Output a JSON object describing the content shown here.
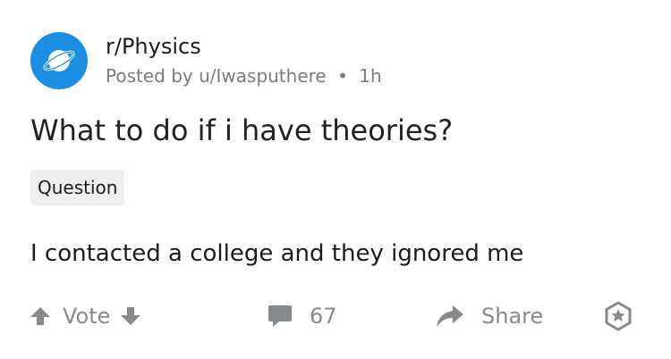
{
  "post": {
    "subreddit": "r/Physics",
    "author_prefix": "Posted by",
    "author": "u/Iwasputhere",
    "separator": "•",
    "time": "1h",
    "title": "What to do if i have theories?",
    "flair": "Question",
    "body": "I contacted a college and they ignored me"
  },
  "actions": {
    "vote_label": "Vote",
    "comment_count": "67",
    "share_label": "Share"
  },
  "icons": {
    "avatar": "planet-icon",
    "upvote": "arrow-up-icon",
    "downvote": "arrow-down-icon",
    "comment": "comment-bubble-icon",
    "share": "share-arrow-icon",
    "award": "award-icon"
  },
  "colors": {
    "avatar_bg": "#1a8fe3",
    "muted_text": "#878a8c",
    "flair_bg": "#edeff1",
    "title_text": "#222222"
  }
}
